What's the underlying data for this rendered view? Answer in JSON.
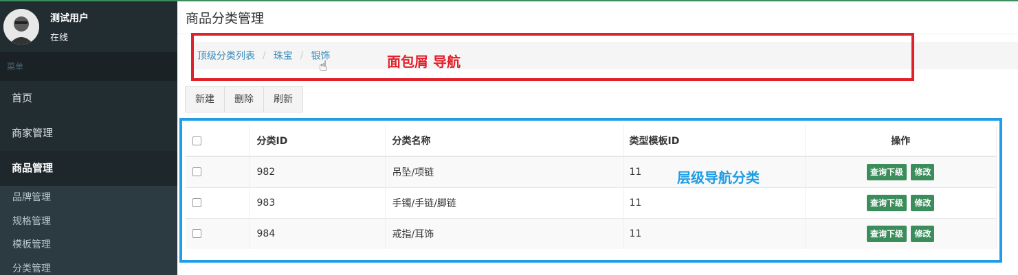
{
  "user": {
    "name": "测试用户",
    "status": "在线"
  },
  "sidebar": {
    "header": "菜单",
    "items": [
      {
        "label": "首页"
      },
      {
        "label": "商家管理"
      },
      {
        "label": "商品管理"
      }
    ],
    "subitems": [
      {
        "label": "品牌管理"
      },
      {
        "label": "规格管理"
      },
      {
        "label": "模板管理"
      },
      {
        "label": "分类管理"
      }
    ]
  },
  "page": {
    "title": "商品分类管理"
  },
  "breadcrumb": {
    "items": [
      "顶级分类列表",
      "珠宝",
      "银饰"
    ],
    "separator": "/"
  },
  "toolbar": {
    "new_label": "新建",
    "delete_label": "删除",
    "refresh_label": "刷新"
  },
  "table": {
    "headers": {
      "id": "分类ID",
      "name": "分类名称",
      "type": "类型模板ID",
      "op": "操作"
    },
    "rows": [
      {
        "id": "982",
        "name": "吊坠/项链",
        "type": "11"
      },
      {
        "id": "983",
        "name": "手镯/手链/脚链",
        "type": "11"
      },
      {
        "id": "984",
        "name": "戒指/耳饰",
        "type": "11"
      }
    ],
    "actions": {
      "query": "查询下级",
      "edit": "修改"
    }
  },
  "annotations": {
    "breadcrumb_note": "面包屑 导航",
    "table_note": "层级导航分类"
  },
  "colors": {
    "annotation_red": "#e2202c",
    "annotation_blue": "#1f9de5",
    "action_green": "#3c8d5c",
    "link_blue": "#3c8dbc"
  },
  "icons": {
    "cursor": "hand-pointer-icon"
  }
}
